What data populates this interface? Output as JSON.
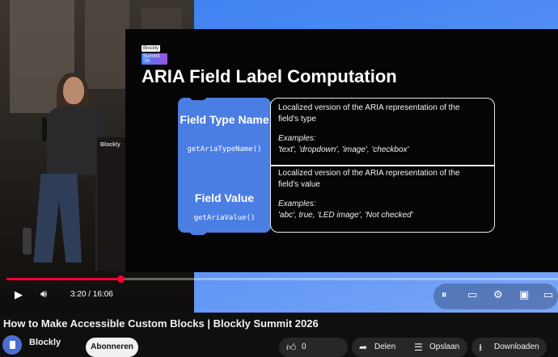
{
  "player": {
    "time_display": "3:20 / 16:06",
    "progress_fraction": 0.207,
    "podium_label": "Blockly"
  },
  "slide": {
    "logo_line1": "Blockly",
    "logo_line2": "Summit '26",
    "title": "ARIA Field Label Computation",
    "rows": [
      {
        "block_name": "Field Type Name",
        "function": "getAriaTypeName()",
        "description": "Localized version of the ARIA representation of the field's type",
        "examples_label": "Examples:",
        "examples": "'text', 'dropdown', 'image', 'checkbox'"
      },
      {
        "block_name": "Field Value",
        "function": "getAriaValue()",
        "description": "Localized version of the ARIA representation of the field's value",
        "examples_label": "Examples:",
        "examples": "'abc', true, 'LED image', 'Not checked'"
      }
    ]
  },
  "video": {
    "title": "How to Make Accessible Custom Blocks | Blockly Summit 2026",
    "channel": "Blockly",
    "subscribe_label": "Abonneren",
    "likes": "0",
    "share_label": "Delen",
    "save_label": "Opslaan",
    "download_label": "Downloaden"
  },
  "colors": {
    "accent": "#ff0033",
    "block_blue": "#4b7ee3",
    "background": "#0f0f0f"
  }
}
